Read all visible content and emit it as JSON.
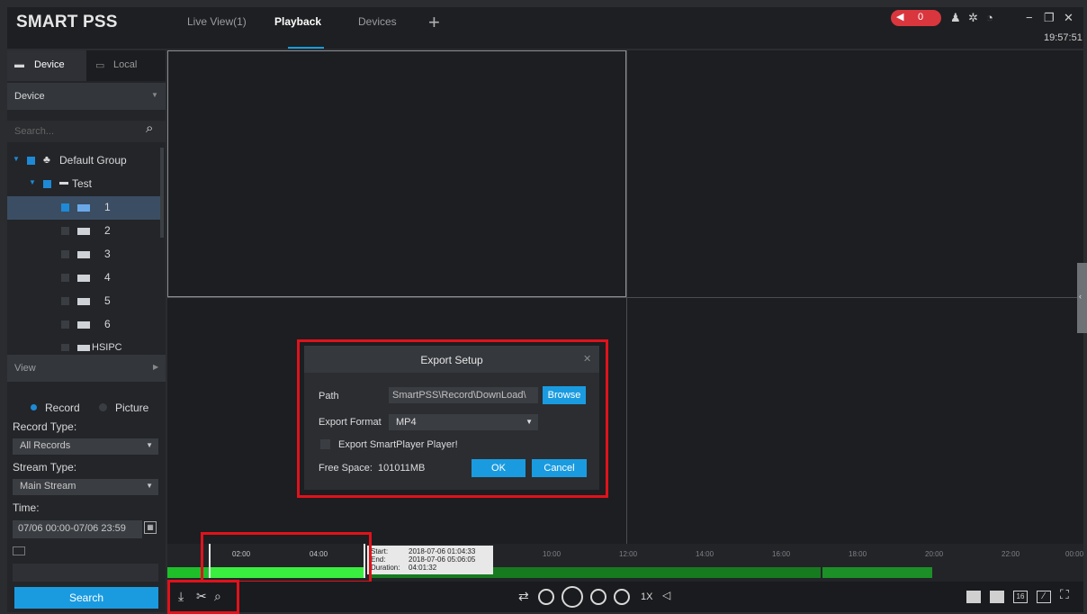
{
  "app": {
    "title": "SMART PSS",
    "time": "19:57:51",
    "alarm_count": "0"
  },
  "tabs": [
    {
      "label": "Live View(1)"
    },
    {
      "label": "Playback"
    },
    {
      "label": "Devices"
    }
  ],
  "left": {
    "tab_device": "Device",
    "tab_local": "Local",
    "section_device": "Device",
    "search_placeholder": "Search...",
    "tree": [
      {
        "label": "Default Group"
      },
      {
        "label": "Test"
      },
      {
        "label": "1",
        "checked": true
      },
      {
        "label": "2"
      },
      {
        "label": "3"
      },
      {
        "label": "4"
      },
      {
        "label": "5"
      },
      {
        "label": "6"
      },
      {
        "label": "HSIPC"
      }
    ],
    "section_view": "View",
    "radio_record": "Record",
    "radio_picture": "Picture",
    "record_type_label": "Record Type:",
    "record_type_value": "All Records",
    "stream_type_label": "Stream Type:",
    "stream_type_value": "Main Stream",
    "time_label": "Time:",
    "time_value": "07/06 00:00-07/06 23:59",
    "search_button": "Search"
  },
  "dialog": {
    "title": "Export Setup",
    "path_label": "Path",
    "path_value": "SmartPSS\\Record\\DownLoad\\",
    "browse": "Browse",
    "format_label": "Export Format",
    "format_value": "MP4",
    "export_player": "Export SmartPlayer Player!",
    "free_space_label": "Free Space:",
    "free_space_value": "101011MB",
    "ok": "OK",
    "cancel": "Cancel"
  },
  "timeline": {
    "ticks": [
      "02:00",
      "04:00",
      "10:00",
      "12:00",
      "14:00",
      "16:00",
      "18:00",
      "20:00",
      "22:00",
      "00:00"
    ],
    "tooltip": {
      "start_label": "Start:",
      "start": "2018-07-06 01:04:33",
      "end_label": "End:",
      "end": "2018-07-06 05:06:05",
      "duration_label": "Duration:",
      "duration": "04:01:32"
    }
  },
  "playback": {
    "speed": "1X",
    "layout_16": "16"
  },
  "colors": {
    "accent": "#1a9be0",
    "highlight_box": "#e0121b",
    "record_green": "#3aee3f"
  }
}
